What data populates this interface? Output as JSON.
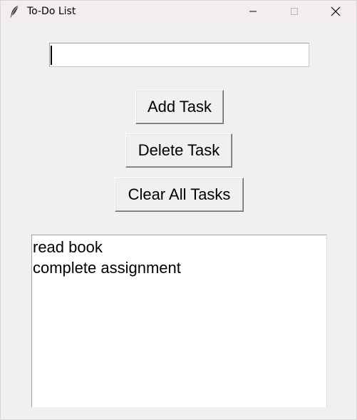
{
  "window": {
    "title": "To-Do List",
    "icon": "feather-icon",
    "controls": {
      "minimize": "minimize-icon",
      "maximize": "maximize-icon",
      "close": "close-icon"
    }
  },
  "entry": {
    "value": "",
    "placeholder": ""
  },
  "buttons": {
    "add": "Add Task",
    "delete": "Delete Task",
    "clear": "Clear All Tasks"
  },
  "tasks": [
    "read book",
    "complete assignment"
  ],
  "colors": {
    "background": "#f0f0f0",
    "titlebar": "#f3eded",
    "list_background": "#ffffff"
  }
}
